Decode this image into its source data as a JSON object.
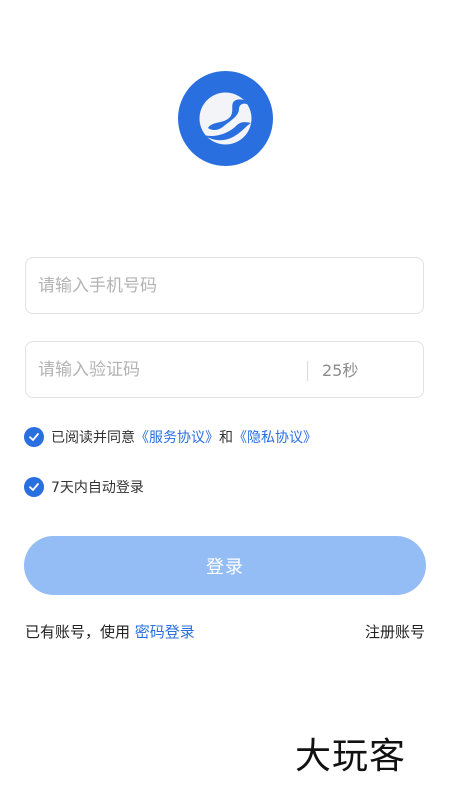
{
  "login": {
    "phone_placeholder": "请输入手机号码",
    "code_placeholder": "请输入验证码",
    "countdown": "25秒",
    "agree_prefix": "已阅读并同意",
    "service_agreement": "《服务协议》",
    "and": "和",
    "privacy_agreement": "《隐私协议》",
    "auto_login": "7天内自动登录",
    "login_button": "登录",
    "have_account": "已有账号，使用",
    "password_login": "密码登录",
    "register": "注册账号"
  },
  "icons": {
    "logo": "app-logo-icon",
    "agree_check": "check-icon",
    "auto_check": "check-icon"
  },
  "colors": {
    "primary": "#2a6fe0",
    "button_disabled": "#94bdf5",
    "placeholder": "#b3b3b3",
    "border": "#e1e1e1"
  },
  "watermark": "大玩客"
}
